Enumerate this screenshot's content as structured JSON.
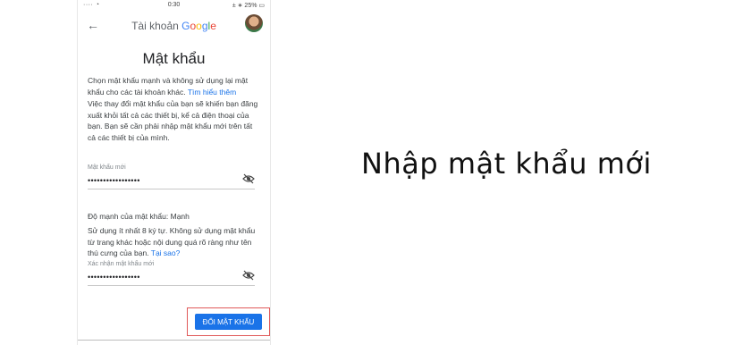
{
  "status_bar": {
    "left": "···· ◔",
    "time": "0:30",
    "right": "± ∗ 25% ▭"
  },
  "app_bar": {
    "title_prefix": "Tài khoản ",
    "google": [
      "G",
      "o",
      "o",
      "g",
      "l",
      "e"
    ]
  },
  "page": {
    "heading": "Mật khẩu"
  },
  "intro": {
    "text": "Chọn mật khẩu mạnh và không sử dụng lại mật khẩu cho các tài khoản khác. ",
    "link": "Tìm hiểu thêm"
  },
  "notice": "Việc thay đổi mật khẩu của bạn sẽ khiến bạn đăng xuất khỏi tất cả các thiết bị, kể cả điện thoại của bạn. Bạn sẽ cần phải nhập mật khẩu mới trên tất cả các thiết bị của mình.",
  "new_password": {
    "label": "Mật khẩu mới",
    "value": "•••••••••••••••••"
  },
  "strength": {
    "label": "Độ mạnh của mật khẩu: ",
    "value": "Mạnh"
  },
  "hint": {
    "text": "Sử dụng ít nhất 8 ký tự. Không sử dụng mật khẩu từ trang khác hoặc nội dung quá rõ ràng như tên thú cưng của bạn. ",
    "link": "Tại sao?"
  },
  "confirm_password": {
    "label": "Xác nhận mật khẩu mới",
    "value": "•••••••••••••••••"
  },
  "submit_label": "ĐỔI MẬT KHẨU",
  "caption": "Nhập mật khẩu mới",
  "colors": {
    "accent": "#1a73e8",
    "highlight_border": "#e05a5a"
  }
}
